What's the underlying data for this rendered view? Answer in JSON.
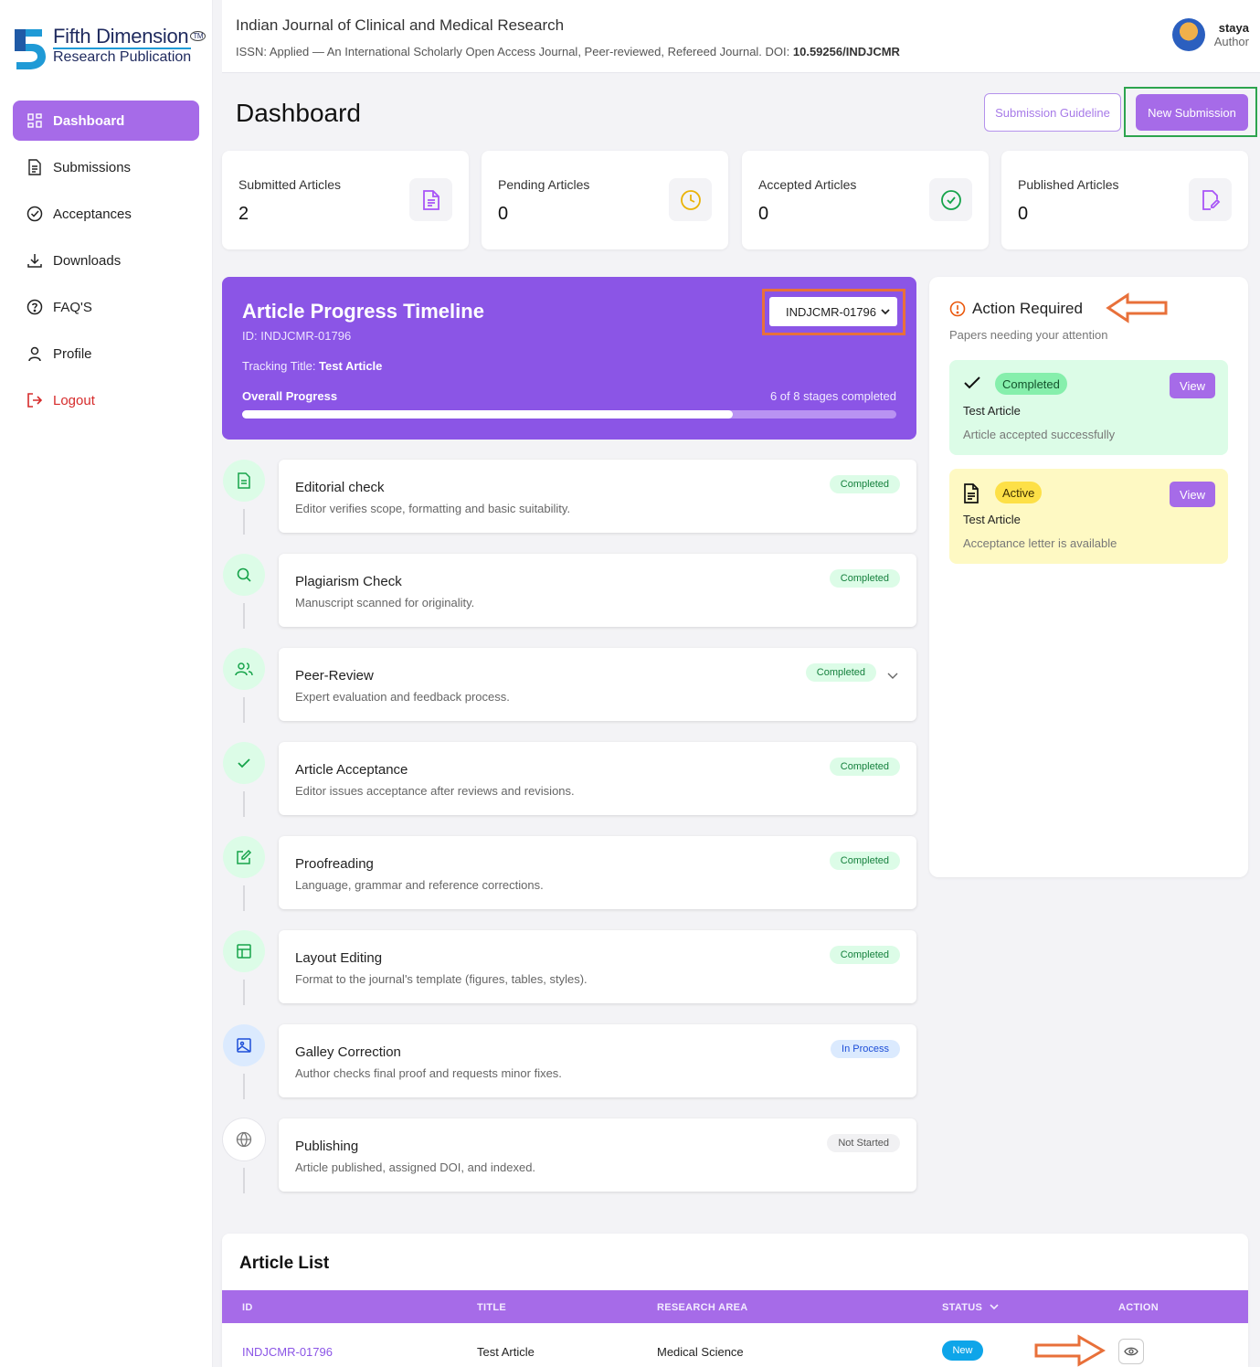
{
  "brand": {
    "line1": "Fifth Dimension",
    "line2": "Research Publication",
    "tm": "TM"
  },
  "sidebar": {
    "items": [
      {
        "label": "Dashboard",
        "icon": "grid-icon"
      },
      {
        "label": "Submissions",
        "icon": "document-icon"
      },
      {
        "label": "Acceptances",
        "icon": "check-circle-icon"
      },
      {
        "label": "Downloads",
        "icon": "download-icon"
      },
      {
        "label": "FAQ'S",
        "icon": "help-circle-icon"
      },
      {
        "label": "Profile",
        "icon": "user-icon"
      },
      {
        "label": "Logout",
        "icon": "logout-icon"
      }
    ]
  },
  "header": {
    "title": "Indian Journal of Clinical and Medical Research",
    "subtitle": "ISSN: Applied — An International Scholarly Open Access Journal, Peer-reviewed, Refereed Journal. DOI: ",
    "doi": "10.59256/INDJCMR",
    "user_name": "staya",
    "user_role": "Author"
  },
  "page": {
    "title": "Dashboard",
    "guideline_button": "Submission Guideline",
    "new_submission_button": "New Submission"
  },
  "stats": [
    {
      "label": "Submitted Articles",
      "value": "2",
      "icon": "document-icon",
      "color": "#a855f7"
    },
    {
      "label": "Pending Articles",
      "value": "0",
      "icon": "clock-icon",
      "color": "#eab308"
    },
    {
      "label": "Accepted Articles",
      "value": "0",
      "icon": "check-circle-icon",
      "color": "#16a34a"
    },
    {
      "label": "Published Articles",
      "value": "0",
      "icon": "edit-document-icon",
      "color": "#a855f7"
    }
  ],
  "timeline": {
    "title": "Article Progress Timeline",
    "id_text": "ID: INDJCMR-01796",
    "tracking_label": "Tracking Title: ",
    "tracking_title": "Test Article",
    "overall_label": "Overall Progress",
    "stages_text": "6 of 8 stages completed",
    "progress": 0.75,
    "selected_article": "INDJCMR-01796"
  },
  "stages": [
    {
      "name": "Editorial check",
      "desc": "Editor verifies scope, formatting and basic suitability.",
      "status": "Completed",
      "icon": "document-icon"
    },
    {
      "name": "Plagiarism Check",
      "desc": "Manuscript scanned for originality.",
      "status": "Completed",
      "icon": "search-icon"
    },
    {
      "name": "Peer-Review",
      "desc": "Expert evaluation and feedback process.",
      "status": "Completed",
      "icon": "users-icon"
    },
    {
      "name": "Article Acceptance",
      "desc": "Editor issues acceptance after reviews and revisions.",
      "status": "Completed",
      "icon": "check-icon"
    },
    {
      "name": "Proofreading",
      "desc": "Language, grammar and reference corrections.",
      "status": "Completed",
      "icon": "edit-icon"
    },
    {
      "name": "Layout Editing",
      "desc": "Format to the journal's template (figures, tables, styles).",
      "status": "Completed",
      "icon": "layout-icon"
    },
    {
      "name": "Galley Correction",
      "desc": "Author checks final proof and requests minor fixes.",
      "status": "In Process",
      "icon": "image-icon"
    },
    {
      "name": "Publishing",
      "desc": "Article published, assigned DOI, and indexed.",
      "status": "Not Started",
      "icon": "globe-icon"
    }
  ],
  "action_required": {
    "title": "Action Required",
    "subtitle": "Papers needing your attention",
    "cards": [
      {
        "badge": "Completed",
        "title": "Test Article",
        "desc": "Article accepted successfully",
        "button": "View",
        "icon": "check-icon"
      },
      {
        "badge": "Active",
        "title": "Test Article",
        "desc": "Acceptance letter is available",
        "button": "View",
        "icon": "document-icon"
      }
    ]
  },
  "article_list": {
    "title": "Article List",
    "columns": [
      "ID",
      "TITLE",
      "RESEARCH AREA",
      "STATUS",
      "ACTION"
    ],
    "rows": [
      {
        "id": "INDJCMR-01796",
        "title": "Test Article",
        "area": "Medical Science",
        "status": "New"
      }
    ]
  }
}
